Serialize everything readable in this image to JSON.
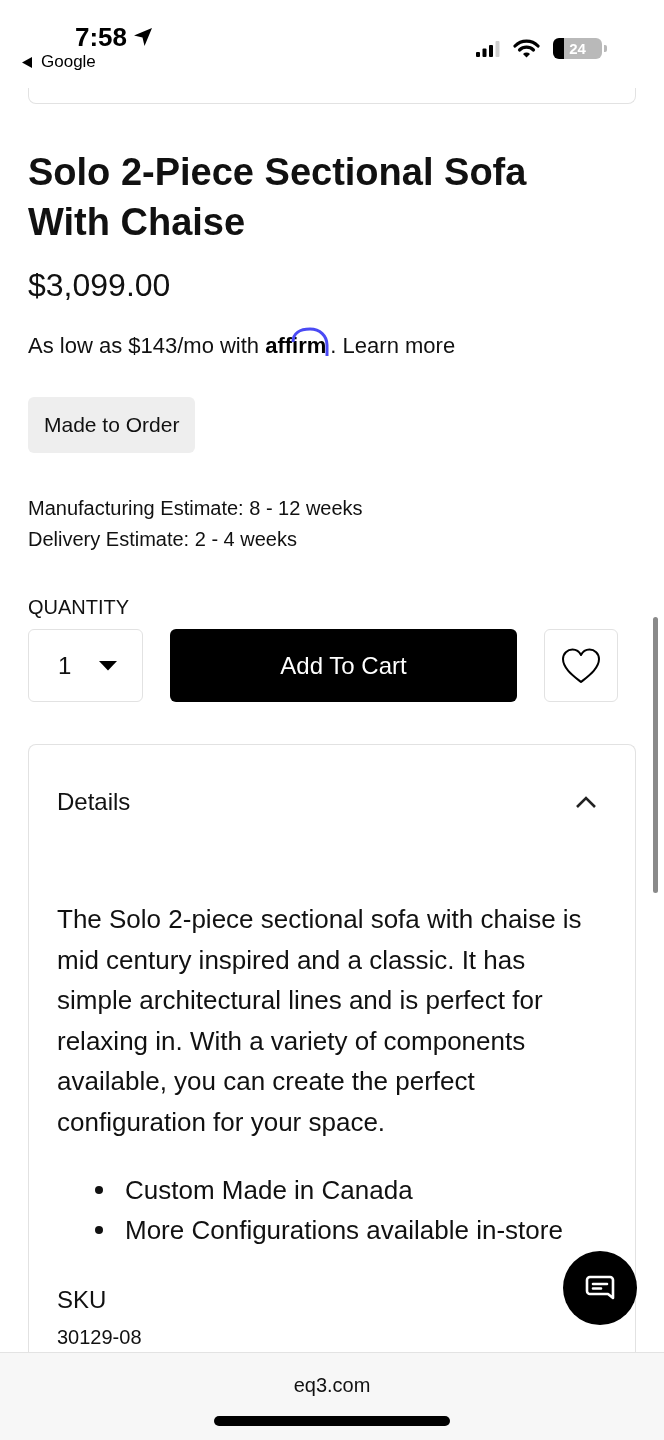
{
  "status_bar": {
    "time": "7:58",
    "back_label": "Google",
    "battery": "24"
  },
  "product": {
    "title": "Solo 2-Piece Sectional Sofa With Chaise",
    "price": "$3,099.00",
    "financing": {
      "text": "As low as $143/mo with",
      "logo": "affirm",
      "after": ".",
      "link": "Learn more"
    },
    "badge": "Made to Order",
    "estimates": [
      "Manufacturing Estimate: 8 - 12 weeks",
      "Delivery Estimate: 2 - 4 weeks"
    ]
  },
  "purchase": {
    "quantity_label": "QUANTITY",
    "quantity": "1",
    "add_to_cart": "Add To Cart",
    "wishlisted": false
  },
  "details": {
    "title": "Details",
    "expanded": true,
    "description": "The Solo 2-piece sectional sofa with chaise is mid century inspired and a classic. It has simple architectural lines and is perfect for relaxing in. With a variety of components available, you can create the perfect configuration for your space.",
    "bullets": [
      "Custom Made in Canada",
      "More Configurations available in-store"
    ],
    "sku_label": "SKU",
    "sku": "30129-08"
  },
  "browser": {
    "url": "eq3.com"
  }
}
